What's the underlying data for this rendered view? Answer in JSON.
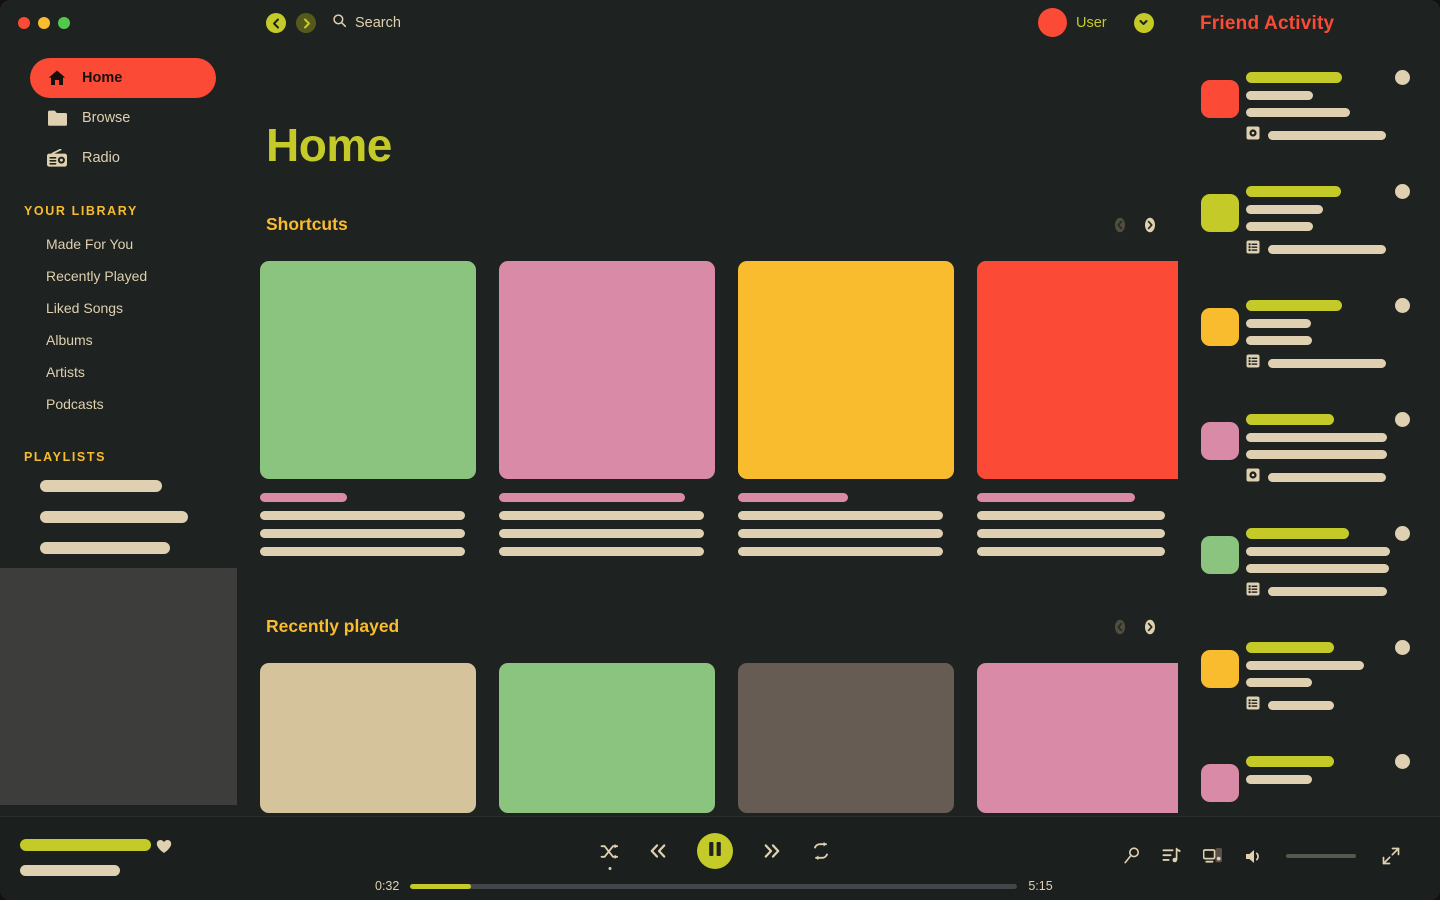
{
  "window": {
    "traffic_lights": [
      "close",
      "minimize",
      "maximize"
    ],
    "back_label": "back",
    "forward_label": "forward"
  },
  "search": {
    "icon": "search-icon",
    "label": "Search"
  },
  "user": {
    "name": "User",
    "avatar_color": "#fb4b36",
    "dropdown_icon": "chevron-down-icon"
  },
  "friend_activity": {
    "title": "Friend Activity",
    "title_color": "#fb4b36",
    "items": [
      {
        "avatar_color": "#fb4b36",
        "name_w": 96,
        "line1_w": 67,
        "line2_w": 104,
        "ctx_icon": "album-disc-icon",
        "ctx_w": 118
      },
      {
        "avatar_color": "#c4cb28",
        "name_w": 95,
        "line1_w": 77,
        "line2_w": 67,
        "ctx_icon": "playlist-icon",
        "ctx_w": 118
      },
      {
        "avatar_color": "#f9bc2e",
        "name_w": 96,
        "line1_w": 65,
        "line2_w": 66,
        "ctx_icon": "playlist-icon",
        "ctx_w": 118
      },
      {
        "avatar_color": "#d98aa7",
        "name_w": 88,
        "line1_w": 141,
        "line2_w": 141,
        "ctx_icon": "album-disc-icon",
        "ctx_w": 118
      },
      {
        "avatar_color": "#8bc47f",
        "name_w": 103,
        "line1_w": 144,
        "line2_w": 143,
        "ctx_icon": "playlist-icon",
        "ctx_w": 119
      },
      {
        "avatar_color": "#f9bc2e",
        "name_w": 88,
        "line1_w": 118,
        "line2_w": 66,
        "ctx_icon": "playlist-icon",
        "ctx_w": 66
      },
      {
        "avatar_color": "#d98aa7",
        "name_w": 88,
        "line1_w": 66,
        "line2_w": 0,
        "ctx_icon": "",
        "ctx_w": 0
      }
    ]
  },
  "sidebar": {
    "nav": [
      {
        "label": "Home",
        "icon": "home-icon",
        "selected": true
      },
      {
        "label": "Browse",
        "icon": "folder-icon",
        "selected": false
      },
      {
        "label": "Radio",
        "icon": "radio-icon",
        "selected": false
      }
    ],
    "library_heading": "YOUR LIBRARY",
    "library_items": [
      "Made For You",
      "Recently Played",
      "Liked Songs",
      "Albums",
      "Artists",
      "Podcasts"
    ],
    "playlists_heading": "PLAYLISTS",
    "playlist_bars": [
      {
        "width": 122
      },
      {
        "width": 148
      }
    ]
  },
  "main": {
    "page_title": "Home",
    "rows": [
      {
        "title": "Shortcuts",
        "prev_enabled": false,
        "next_enabled": true,
        "card_height": "tall",
        "cards": [
          {
            "color": "#8bc47f",
            "title_w": 87,
            "lines": [
              205,
              205,
              205
            ]
          },
          {
            "color": "#d98aa7",
            "title_w": 186,
            "lines": [
              205,
              205,
              205
            ]
          },
          {
            "color": "#f9bc2e",
            "title_w": 110,
            "lines": [
              205,
              205,
              205
            ]
          },
          {
            "color": "#fb4b36",
            "title_w": 158,
            "lines": [
              188,
              188,
              188
            ]
          }
        ]
      },
      {
        "title": "Recently played",
        "prev_enabled": false,
        "next_enabled": true,
        "card_height": "wide",
        "cards": [
          {
            "color": "#d5c49b",
            "title_w": 0,
            "lines": []
          },
          {
            "color": "#8bc47f",
            "title_w": 0,
            "lines": []
          },
          {
            "color": "#665c53",
            "title_w": 0,
            "lines": []
          },
          {
            "color": "#d98aa7",
            "title_w": 0,
            "lines": []
          }
        ]
      }
    ]
  },
  "player": {
    "now_playing": {
      "title_bar_width": 131,
      "artist_bar_width": 100,
      "like_icon": "heart-icon"
    },
    "controls": {
      "shuffle": "shuffle-icon",
      "previous": "previous-icon",
      "play_pause": "pause-icon",
      "next": "next-icon",
      "repeat": "repeat-icon",
      "shuffle_active": true,
      "is_playing": true
    },
    "progress": {
      "elapsed": "0:32",
      "duration": "5:15",
      "percent": 10
    },
    "right_controls": [
      {
        "icon": "microphone-icon",
        "name": "lyrics-button"
      },
      {
        "icon": "queue-icon",
        "name": "queue-button"
      },
      {
        "icon": "devices-icon",
        "name": "connect-device-button"
      },
      {
        "icon": "volume-icon",
        "name": "volume-button"
      }
    ],
    "volume": {
      "percent": 100
    },
    "fullscreen_icon": "fullscreen-icon"
  },
  "colors": {
    "background": "#1e2220",
    "accent_green": "#c4cb28",
    "accent_red": "#fb4b36",
    "accent_yellow": "#f9bc2e",
    "accent_pink": "#d98aa7",
    "text_tan": "#ded0b0"
  }
}
